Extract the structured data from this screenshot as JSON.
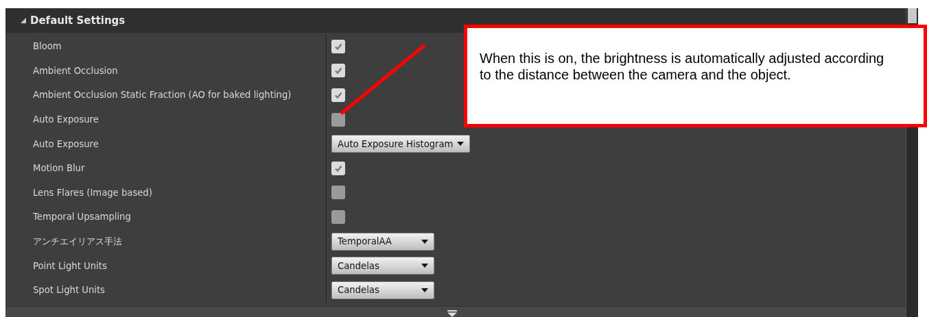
{
  "section": {
    "title": "Default Settings",
    "expanded": true
  },
  "rows": [
    {
      "label": "Bloom",
      "kind": "checkbox",
      "checked": true
    },
    {
      "label": "Ambient Occlusion",
      "kind": "checkbox",
      "checked": true
    },
    {
      "label": "Ambient Occlusion Static Fraction (AO for baked lighting)",
      "kind": "checkbox",
      "checked": true
    },
    {
      "label": "Auto Exposure",
      "kind": "checkbox",
      "checked": false
    },
    {
      "label": "Auto Exposure",
      "kind": "dropdown",
      "value": "Auto Exposure Histogram"
    },
    {
      "label": "Motion Blur",
      "kind": "checkbox",
      "checked": true
    },
    {
      "label": "Lens Flares (Image based)",
      "kind": "checkbox",
      "checked": false
    },
    {
      "label": "Temporal Upsampling",
      "kind": "checkbox",
      "checked": false
    },
    {
      "label": "アンチエイリアス手法",
      "kind": "dropdown",
      "value": "TemporalAA"
    },
    {
      "label": "Point Light Units",
      "kind": "dropdown",
      "value": "Candelas"
    },
    {
      "label": "Spot Light Units",
      "kind": "dropdown",
      "value": "Candelas"
    }
  ],
  "callout": {
    "text": "When this is on, the brightness is automatically adjusted according to the distance between the camera and the object."
  }
}
